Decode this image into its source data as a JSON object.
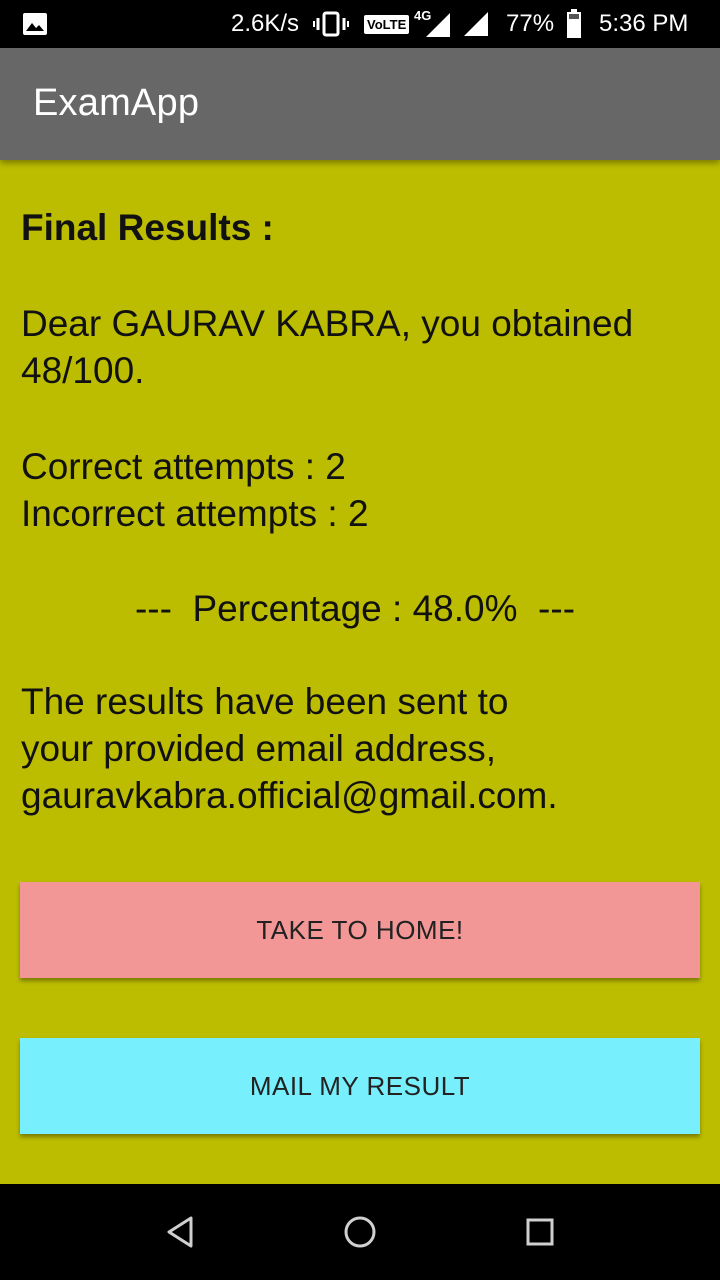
{
  "status_bar": {
    "net_speed": "2.6K/s",
    "volte": "VoLTE",
    "network": "4G",
    "battery": "77%",
    "time": "5:36 PM"
  },
  "app_bar": {
    "title": "ExamApp"
  },
  "results": {
    "heading": "Final Results :",
    "greeting": "Dear GAURAV KABRA, you obtained 48/100.",
    "correct": "Correct attempts : 2",
    "incorrect": "Incorrect attempts : 2",
    "percentage": "---  Percentage : 48.0%  ---",
    "email_note_line1": "The results have been sent to",
    "email_note_line2": "your provided email address,",
    "email_note_line3": "gauravkabra.official@gmail.com."
  },
  "buttons": {
    "home_label": "TAKE TO HOME!",
    "mail_label": "MAIL MY RESULT"
  },
  "colors": {
    "content_bg": "#bcbd00",
    "app_bar_bg": "#676767",
    "home_button_bg": "#f29696",
    "mail_button_bg": "#78effd"
  },
  "icons": {
    "status_left": "image-icon",
    "vibrate": "vibrate-icon",
    "signal": "signal-icon",
    "battery": "battery-icon",
    "nav_back": "back-icon",
    "nav_home": "home-icon",
    "nav_recents": "recents-icon"
  }
}
